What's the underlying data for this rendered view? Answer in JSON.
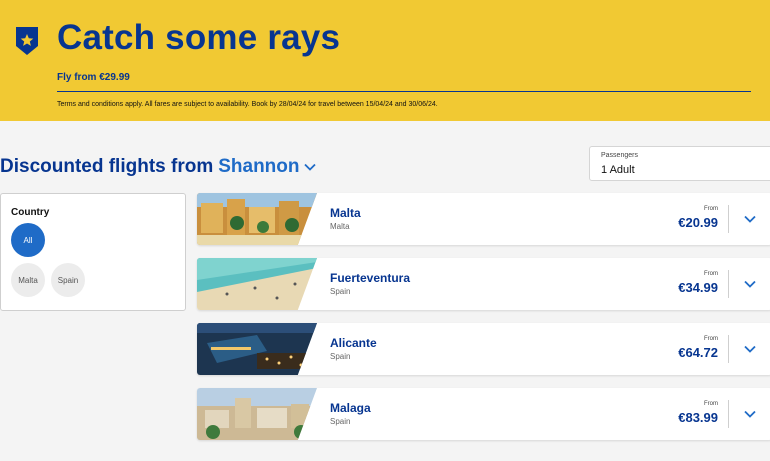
{
  "promo": {
    "title": "Catch some rays",
    "subtitle": "Fly from €29.99",
    "terms": "Terms and conditions apply. All fares are subject to availability. Book by 28/04/24 for travel between 15/04/24 and 30/06/24.",
    "badge_icon": "star-shield-icon",
    "background_color": "#f1c933",
    "brand_color": "#073590"
  },
  "search": {
    "heading_prefix": "Discounted flights from",
    "origin": "Shannon",
    "origin_color": "#1f6bc7",
    "passengers_label": "Passengers",
    "passengers_value": "1 Adult"
  },
  "filter": {
    "title": "Country",
    "options": [
      "All",
      "Malta",
      "Spain"
    ],
    "selected": "All",
    "selected_color": "#1f6bc7"
  },
  "destinations": [
    {
      "city": "Malta",
      "country": "Malta",
      "from_label": "From",
      "price": "€20.99"
    },
    {
      "city": "Fuerteventura",
      "country": "Spain",
      "from_label": "From",
      "price": "€34.99"
    },
    {
      "city": "Alicante",
      "country": "Spain",
      "from_label": "From",
      "price": "€64.72"
    },
    {
      "city": "Malaga",
      "country": "Spain",
      "from_label": "From",
      "price": "€83.99"
    }
  ]
}
